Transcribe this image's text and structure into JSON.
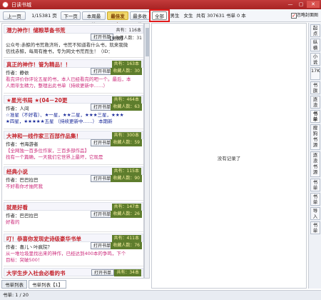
{
  "window": {
    "title": "日读书城",
    "min": "—",
    "max": "▢",
    "close": "✕"
  },
  "toolbar": {
    "prev": "上一页",
    "page": "1/15381 页",
    "next": "下一页",
    "items": [
      "本周最热",
      "最佳发布",
      "最多收藏",
      "全部",
      "男生",
      "女生"
    ],
    "summary": "共有 307631 书单 0 本",
    "ignore": "忽略封面图"
  },
  "cards": [
    {
      "title": "潜力神作！储粮草备书荒",
      "open": "打开书单",
      "tag": "【男频】",
      "meta": "共有：116本",
      "sub": "收藏人数：31",
      "author": "",
      "desc": [
        "公众号:赤鲸的书荒救济所，书荒不知道看什么书，就来我微",
        "信找赤鲸，每周有推书，专为网文书荒而生！（ID："
      ]
    },
    {
      "title": "真正的神作！管为精品！！",
      "open": "打开书单",
      "tag": "【男频】",
      "meta": "共有：163本",
      "sub": "收藏人数：30",
      "author": "作者：静依",
      "desc": [
        "看完评价你评论五星的书，本人已经看完的吧一个。最后，本",
        "人用毕生精力，整理出此书单（持续更新中……）"
      ]
    },
    {
      "title": "★星光书局 ★(04－20更",
      "open": "打开书单",
      "tag": "【男频】",
      "meta": "共有：464本",
      "sub": "收藏人数：63",
      "author": "作者：人间",
      "desc": [
        "☆准星（不好看）、★一星，★★二星，★★★三星，★★★",
        "★四星，★★★★★五星 （持续更新中……）                本期新"
      ]
    },
    {
      "title": "大神和一线作家三百部作品集！",
      "open": "打开书单",
      "tag": "【男频】",
      "meta": "共有：300本",
      "sub": "收藏人数：59",
      "author": "作者：书海游者",
      "desc": [
        "【全网独一百多位作家，三百多部作品】",
        "找有一个篇确，一天我们它世界上最坏，它现是"
      ]
    },
    {
      "title": "经典小说",
      "open": "打开书单",
      "tag": "【男频】",
      "meta": "共有：115本",
      "sub": "收藏人数：90",
      "author": "作者：巴巴拉巴",
      "desc": [
        "不好看你才抽死我"
      ]
    },
    {
      "title": "就是好看",
      "open": "打开书单",
      "tag": "【男频】",
      "meta": "共有：147本",
      "sub": "收藏人数：26",
      "author": "作者：巴巴拉巴",
      "desc": [
        "好看的"
      ]
    },
    {
      "title": "叮！恭喜你发现史诗级豪华书单",
      "open": "打开书单",
      "tag": "【男频】",
      "meta": "共有：411本",
      "sub": "收藏人数：76",
      "author": "作者：喜儿丶叶疯院？",
      "desc": [
        "从一堆垃圾里找出来的神作，已经达到400本的争鸣，下个",
        "目标：突破500！"
      ]
    },
    {
      "title": "大学生步入社会必看的书",
      "open": "打开书单",
      "tag": "",
      "meta": "共有：34本",
      "sub": "",
      "author": "",
      "desc": []
    }
  ],
  "tabs": [
    "书单列表",
    "书单列表【1】"
  ],
  "status": "书单: 1 / 20",
  "content": {
    "empty": "没有记录了"
  },
  "sidebar": [
    "起点",
    "纵横",
    "小说",
    "17K",
    "书旗",
    "逐浪",
    "书单",
    "搜狗书源",
    "逐浪书源",
    "书单",
    "书单",
    "导入",
    "书单"
  ]
}
